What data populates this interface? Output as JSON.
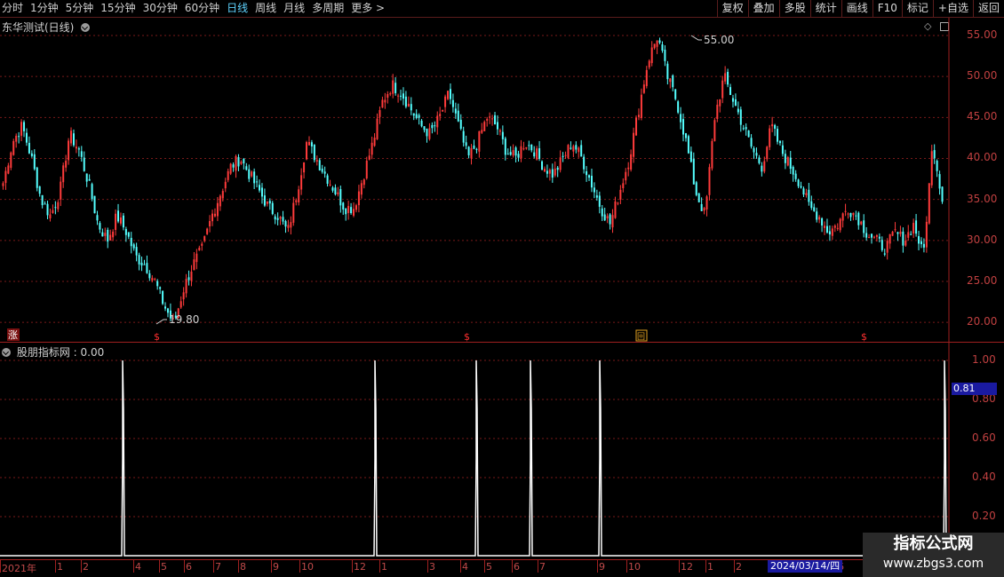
{
  "toolbar": {
    "periods": [
      "分时",
      "1分钟",
      "5分钟",
      "15分钟",
      "30分钟",
      "60分钟",
      "日线",
      "周线",
      "月线",
      "多周期",
      "更多 >"
    ],
    "active_period": "日线",
    "right_buttons": [
      "复权",
      "叠加",
      "多股",
      "统计",
      "画线",
      "F10",
      "标记",
      "+自选",
      "返回"
    ]
  },
  "main_panel": {
    "title": "东华测试(日线)",
    "high_label": "55.00",
    "low_label": "19.80",
    "corner_badge": "涨",
    "signal_glyph": "$",
    "box_glyph": "回",
    "price_ticks": [
      "55.00",
      "50.00",
      "45.00",
      "40.00",
      "35.00",
      "30.00",
      "25.00",
      "20.00"
    ]
  },
  "indicator_panel": {
    "title": "股朋指标网",
    "value": "0.00",
    "ticks": [
      "1.00",
      "0.80",
      "0.60",
      "0.40",
      "0.20"
    ],
    "current_value": "0.81"
  },
  "date_axis": {
    "labels": [
      "2021年",
      "1",
      "2",
      "4",
      "5",
      "6",
      "7",
      "8",
      "9",
      "10",
      "12",
      "1",
      "3",
      "4",
      "5",
      "6",
      "7",
      "9",
      "10",
      "12",
      "1",
      "2",
      "6"
    ],
    "highlighted_date": "2024/03/14/四"
  },
  "watermark": {
    "line1": "指标公式网",
    "line2": "www.zbgs3.com"
  },
  "colors": {
    "up": "#ff3b3b",
    "down": "#54ffff",
    "grid": "#7a1a1a",
    "axis": "#c04040",
    "indicator": "#ffffff"
  },
  "chart_data": {
    "type": "candlestick",
    "title": "东华测试(日线)",
    "ylim": [
      19.8,
      55.0
    ],
    "ticks": [
      55,
      50,
      45,
      40,
      35,
      30,
      25,
      20
    ],
    "series": [
      {
        "values": [
          37,
          42,
          44,
          40,
          35,
          33,
          36,
          43,
          41,
          37,
          32,
          30,
          33,
          31,
          28,
          27,
          25,
          22,
          19.8,
          24,
          27,
          29,
          33,
          36,
          39,
          40,
          38,
          36,
          34,
          33,
          31,
          36,
          42,
          40,
          38,
          36,
          34,
          34,
          38,
          42,
          47,
          49,
          48,
          46,
          44,
          43,
          45,
          48,
          44,
          40,
          42,
          45,
          44,
          41,
          40,
          42,
          41,
          39,
          38,
          40,
          42,
          40,
          37,
          34,
          32,
          36,
          40,
          46,
          52,
          55,
          50,
          47,
          42,
          36,
          33,
          45,
          50,
          47,
          44,
          41,
          39,
          44,
          41,
          39,
          37,
          34,
          33,
          31,
          32,
          34,
          33,
          31,
          30,
          29,
          31,
          30,
          32,
          28,
          42,
          35
        ]
      }
    ],
    "indicator": {
      "name": "股朋指标网",
      "ylim": [
        0,
        1
      ],
      "spikes_at_index": [
        13,
        43,
        55,
        62,
        70,
        99
      ],
      "last_value": 0.81
    }
  }
}
